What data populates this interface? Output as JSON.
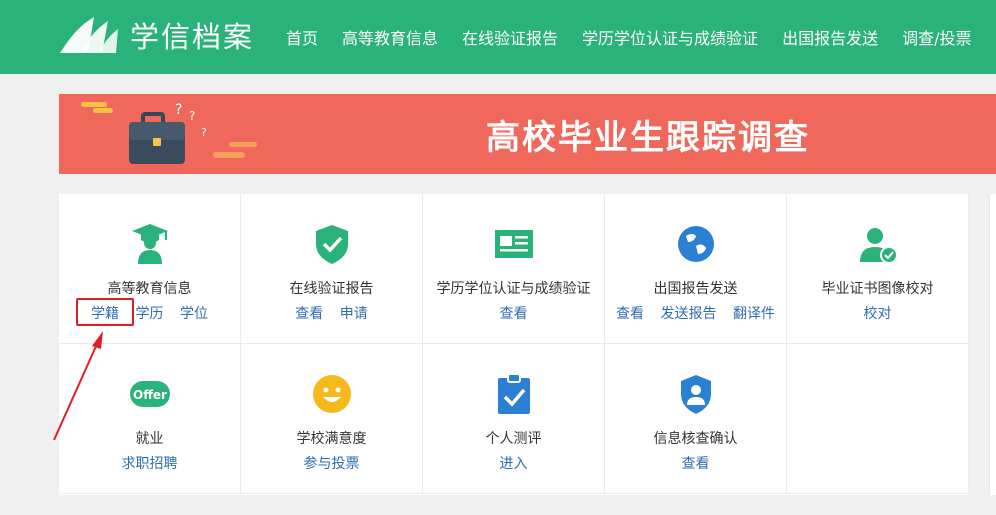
{
  "header": {
    "logo_text": "学信档案",
    "nav": [
      "首页",
      "高等教育信息",
      "在线验证报告",
      "学历学位认证与成绩验证",
      "出国报告发送",
      "调查/投票"
    ]
  },
  "banner": {
    "title": "高校毕业生跟踪调查"
  },
  "services": [
    {
      "title": "高等教育信息",
      "icon": "graduate-icon",
      "links": [
        "学籍",
        "学历",
        "学位"
      ]
    },
    {
      "title": "在线验证报告",
      "icon": "shield-check-icon",
      "links": [
        "查看",
        "申请"
      ]
    },
    {
      "title": "学历学位认证与成绩验证",
      "icon": "id-card-icon",
      "links": [
        "查看"
      ]
    },
    {
      "title": "出国报告发送",
      "icon": "globe-icon",
      "links": [
        "查看",
        "发送报告",
        "翻译件"
      ]
    },
    {
      "title": "毕业证书图像校对",
      "icon": "user-check-icon",
      "links": [
        "校对"
      ]
    },
    {
      "title": "就业",
      "icon": "offer-icon",
      "links": [
        "求职招聘"
      ]
    },
    {
      "title": "学校满意度",
      "icon": "smiley-icon",
      "links": [
        "参与投票"
      ]
    },
    {
      "title": "个人测评",
      "icon": "clipboard-check-icon",
      "links": [
        "进入"
      ]
    },
    {
      "title": "信息核查确认",
      "icon": "user-shield-icon",
      "links": [
        "查看"
      ]
    }
  ],
  "offer_icon_text": "Offer",
  "colors": {
    "header": "#2ab27b",
    "banner": "#f0675b",
    "link": "#2e6eb3",
    "icon_green": "#2ab27b",
    "icon_blue": "#2c80d3",
    "icon_yellow": "#f5b91b",
    "annotation_red": "#e02020"
  }
}
